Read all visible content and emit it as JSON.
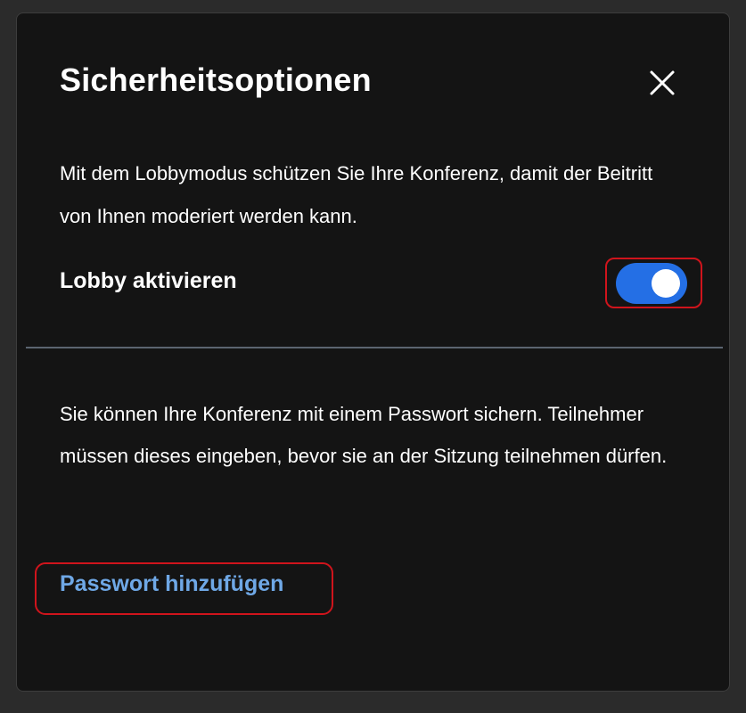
{
  "dialog": {
    "title": "Sicherheitsoptionen",
    "close_icon": "close-icon"
  },
  "lobby": {
    "description": "Mit dem Lobbymodus schützen Sie Ihre Konferenz, damit der Beitritt von Ihnen moderiert werden kann.",
    "label": "Lobby aktivieren",
    "enabled": true
  },
  "password": {
    "description": "Sie können Ihre Konferenz mit einem Passwort sichern. Teilnehmer müssen dieses eingeben, bevor sie an der Sitzung teilnehmen dürfen.",
    "add_label": "Passwort hinzufügen"
  },
  "colors": {
    "background": "#141414",
    "toggle_on": "#246fe5",
    "link": "#6fa8e6",
    "highlight": "#d0141c"
  }
}
